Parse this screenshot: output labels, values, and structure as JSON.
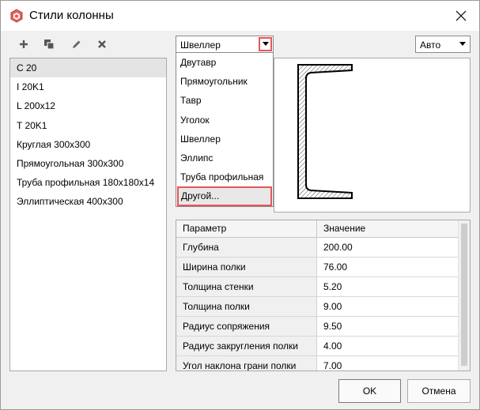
{
  "window": {
    "title": "Стили колонны"
  },
  "toolbar": {
    "icons": [
      "plus-icon",
      "copy-icon",
      "edit-icon",
      "delete-icon"
    ]
  },
  "styles_list": {
    "items": [
      "C 20",
      "I 20K1",
      "L 200x12",
      "T 20K1",
      "Круглая 300x300",
      "Прямоугольная 300x300",
      "Труба профильная 180x180x14",
      "Эллиптическая 400x300"
    ],
    "selected_index": 0
  },
  "profile_combo": {
    "value": "Швеллер"
  },
  "profile_dropdown": {
    "items": [
      "Двутавр",
      "Прямоугольник",
      "Тавр",
      "Уголок",
      "Швеллер",
      "Эллипс",
      "Труба профильная",
      "Другой..."
    ],
    "highlighted_index": 7
  },
  "mode_combo": {
    "value": "Авто"
  },
  "params_table": {
    "headers": [
      "Параметр",
      "Значение"
    ],
    "rows": [
      [
        "Глубина",
        "200.00"
      ],
      [
        "Ширина полки",
        "76.00"
      ],
      [
        "Толщина стенки",
        "5.20"
      ],
      [
        "Толщина полки",
        "9.00"
      ],
      [
        "Радиус сопряжения",
        "9.50"
      ],
      [
        "Радиус закругления полки",
        "4.00"
      ],
      [
        "Угол наклона грани полки",
        "7.00"
      ]
    ]
  },
  "buttons": {
    "ok": "OK",
    "cancel": "Отмена"
  },
  "colors": {
    "highlight": "#e5555a",
    "app_icon": "#d9534f"
  }
}
